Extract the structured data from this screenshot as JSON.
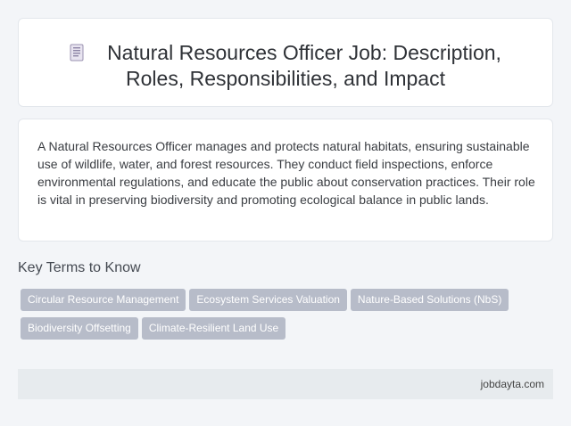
{
  "header": {
    "icon": "document-icon",
    "title_line1": "Natural Resources Officer Job: Description,",
    "title_line2": "Roles, Responsibilities, and Impact"
  },
  "description": "A Natural Resources Officer manages and protects natural habitats, ensuring sustainable use of wildlife, water, and forest resources. They conduct field inspections, enforce environmental regulations, and educate the public about conservation practices. Their role is vital in preserving biodiversity and promoting ecological balance in public lands.",
  "key_terms": {
    "heading": "Key Terms to Know",
    "items": [
      "Circular Resource Management",
      "Ecosystem Services Valuation",
      "Nature-Based Solutions (NbS)",
      "Biodiversity Offsetting",
      "Climate-Resilient Land Use"
    ]
  },
  "footer": {
    "site": "jobdayta.com"
  },
  "colors": {
    "tag_bg": "#b7bcc9",
    "page_bg": "#f3f5f8",
    "footer_bg": "#e7ebee"
  }
}
